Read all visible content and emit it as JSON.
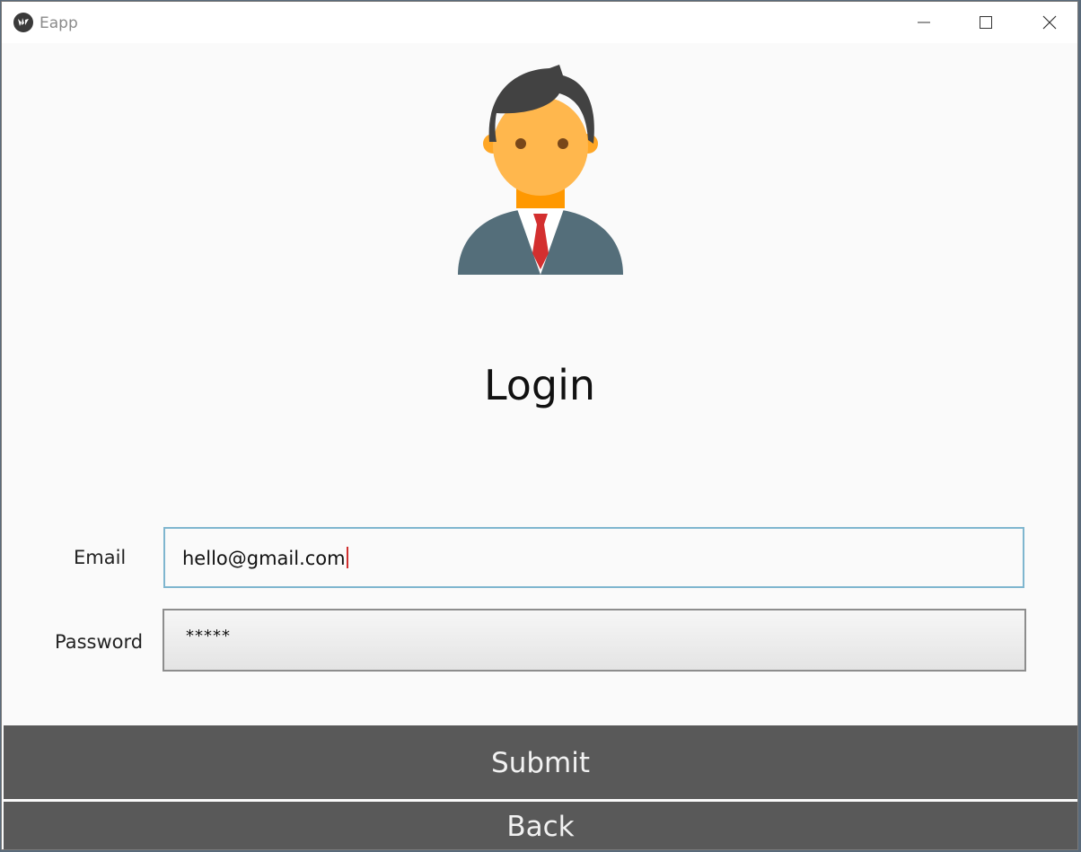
{
  "window": {
    "title": "Eapp",
    "app_icon": "kivy-logo-icon",
    "controls": [
      "minimize-icon",
      "maximize-icon",
      "close-icon"
    ]
  },
  "avatar": {
    "icon": "businessman-avatar-icon"
  },
  "login": {
    "title": "Login",
    "email_label": "Email",
    "email_value": "hello@gmail.com",
    "password_label": "Password",
    "password_value": "*****"
  },
  "buttons": {
    "submit": "Submit",
    "back": "Back"
  },
  "colors": {
    "button_bg": "#595959",
    "focus_border": "#7fb6cf",
    "caret": "#d0302f",
    "avatar_skin": "#ffb74d",
    "avatar_suit": "#546e7a",
    "avatar_tie": "#d32f2f"
  }
}
